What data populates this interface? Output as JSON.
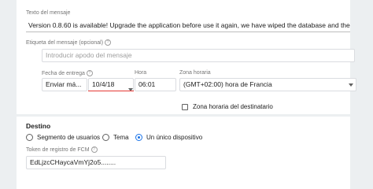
{
  "message": {
    "text_label": "Texto del mensaje",
    "text_value": "Version 0.8.60 is available! Upgrade the application before use it again, we have wiped the database and the version shou",
    "tag_label": "Etiqueta del mensaje (opcional)",
    "tag_placeholder": "Introducir apodo del mensaje",
    "date_label": "Fecha de entrega",
    "send_option": "Enviar má...",
    "date_value": "10/4/18",
    "time_label": "Hora",
    "time_value": "06:01",
    "tz_label": "Zona horaria",
    "tz_value": "(GMT+02:00) hora de Francia",
    "recipient_tz_label": "Zona horaria del destinatario",
    "help_glyph": "?"
  },
  "target": {
    "heading": "Destino",
    "options": [
      "Segmento de usuarios",
      "Tema",
      "Un único dispositivo"
    ],
    "selected_option": "Un único dispositivo",
    "token_label": "Token de registro de FCM",
    "token_value": "EdLjzcCHaycaVmYj2o5........"
  },
  "colors": {
    "accent": "#1a73e8",
    "error_underline": "#e53935",
    "page_bg": "#eceff1"
  }
}
